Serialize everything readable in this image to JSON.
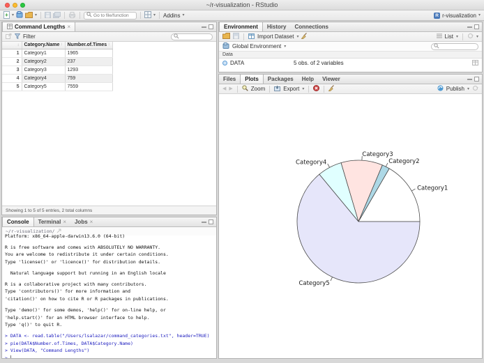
{
  "window": {
    "title": "~/r-visualization - RStudio"
  },
  "toolbar": {
    "goto_placeholder": "Go to file/function",
    "addins_label": "Addins",
    "project_label": "r-visualization"
  },
  "icons": {
    "caret": "▾",
    "close": "×",
    "sort": "↕",
    "back": "◀",
    "forward": "▶",
    "refresh": "↻"
  },
  "data_viewer": {
    "tab_title": "Command Lengths",
    "filter_label": "Filter",
    "columns": [
      "Category.Name",
      "Number.of.Times"
    ],
    "rows": [
      [
        "1",
        "Category1",
        "1965"
      ],
      [
        "2",
        "Category2",
        "237"
      ],
      [
        "3",
        "Category3",
        "1293"
      ],
      [
        "4",
        "Category4",
        "759"
      ],
      [
        "5",
        "Category5",
        "7559"
      ]
    ],
    "status": "Showing 1 to 5 of 5 entries, 2 total columns"
  },
  "environment": {
    "tabs": [
      "Environment",
      "History",
      "Connections"
    ],
    "import_dataset_label": "Import Dataset",
    "list_label": "List",
    "global_env_label": "Global Environment",
    "section_header": "Data",
    "objects": [
      {
        "name": "DATA",
        "summary": "5 obs. of 2 variables"
      }
    ]
  },
  "plots_panel": {
    "tabs": [
      "Files",
      "Plots",
      "Packages",
      "Help",
      "Viewer"
    ],
    "active_tab": "Plots",
    "zoom_label": "Zoom",
    "export_label": "Export",
    "publish_label": "Publish"
  },
  "console": {
    "tabs": [
      "Console",
      "Terminal",
      "Jobs"
    ],
    "working_directory": "~/r-visualization/",
    "output_lines": [
      "Platform: x86_64-apple-darwin13.6.0 (64-bit)",
      "",
      "R is free software and comes with ABSOLUTELY NO WARRANTY.",
      "You are welcome to redistribute it under certain conditions.",
      "Type 'license()' or 'licence()' for distribution details.",
      "",
      "  Natural language support but running in an English locale",
      "",
      "R is a collaborative project with many contributors.",
      "Type 'contributors()' for more information and",
      "'citation()' on how to cite R or R packages in publications.",
      "",
      "Type 'demo()' for some demos, 'help()' for on-line help, or",
      "'help.start()' for an HTML browser interface to help.",
      "Type 'q()' to quit R.",
      ""
    ],
    "commands": [
      "DATA <- read.table(\"/Users/lsalazar/command_categories.txt\", header=TRUE)",
      "pie(DATA$Number.of.Times, DATA$Category.Name)",
      "View(DATA, \"Command Lengths\")"
    ],
    "prompt": ">"
  },
  "chart_data": {
    "type": "pie",
    "title": "",
    "categories": [
      "Category1",
      "Category2",
      "Category3",
      "Category4",
      "Category5"
    ],
    "values": [
      1965,
      237,
      1293,
      759,
      7559
    ],
    "colors": [
      "#FFFFFF",
      "#ADD8E6",
      "#FFE4E1",
      "#E0FFFF",
      "#E6E6FA"
    ],
    "edge_color": "#4a4a4a",
    "start_angle_deg": 0,
    "direction": "counterclockwise",
    "labels_on_slices": true,
    "legend": "none"
  }
}
